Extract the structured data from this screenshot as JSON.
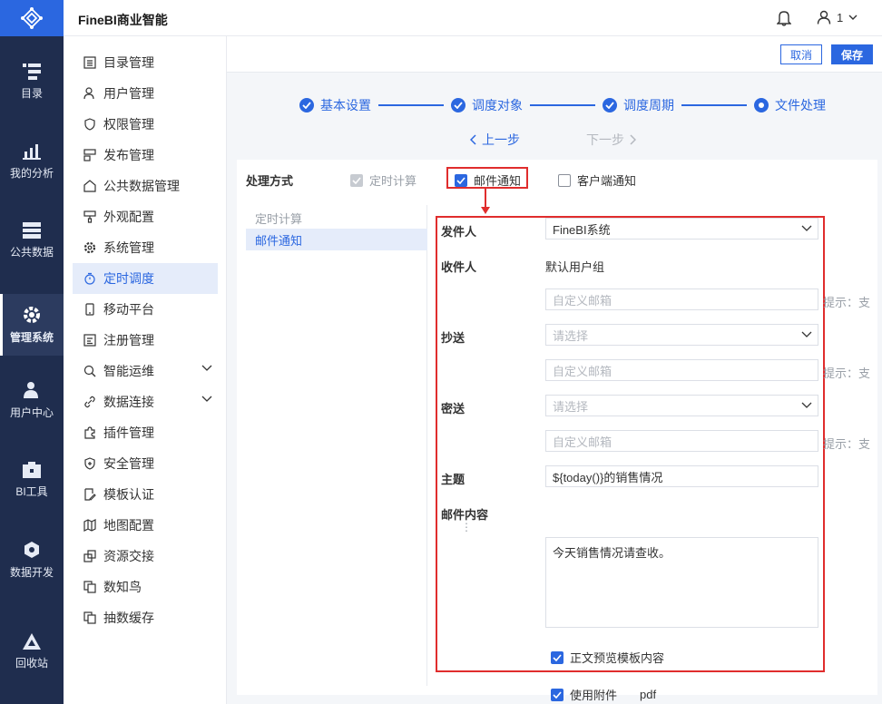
{
  "app": {
    "title": "FineBI商业智能",
    "user": "1"
  },
  "rail": [
    {
      "label": "目录",
      "icon": "catalog-icon"
    },
    {
      "label": "我的分析",
      "icon": "analysis-icon"
    },
    {
      "label": "公共数据",
      "icon": "data-icon"
    },
    {
      "label": "管理系统",
      "icon": "gear-icon"
    },
    {
      "label": "用户中心",
      "icon": "user-center-icon"
    },
    {
      "label": "BI工具",
      "icon": "toolbox-icon"
    },
    {
      "label": "数据开发",
      "icon": "dev-icon"
    },
    {
      "label": "回收站",
      "icon": "recycle-icon"
    }
  ],
  "menu": [
    "目录管理",
    "用户管理",
    "权限管理",
    "发布管理",
    "公共数据管理",
    "外观配置",
    "系统管理",
    "定时调度",
    "移动平台",
    "注册管理",
    "智能运维",
    "数据连接",
    "插件管理",
    "安全管理",
    "模板认证",
    "地图配置",
    "资源交接",
    "数知鸟",
    "抽数缓存"
  ],
  "actions": {
    "cancel": "取消",
    "save": "保存"
  },
  "steps": [
    "基本设置",
    "调度对象",
    "调度周期",
    "文件处理"
  ],
  "nav": {
    "prev": "上一步",
    "next": "下一步"
  },
  "process": {
    "label": "处理方式",
    "options": {
      "timer": "定时计算",
      "email": "邮件通知",
      "client": "客户端通知"
    }
  },
  "subnav": {
    "timer": "定时计算",
    "email": "邮件通知"
  },
  "form": {
    "sender_label": "发件人",
    "sender_value": "FineBI系统",
    "recipient_label": "收件人",
    "recipient_value": "默认用户组",
    "custom_email_placeholder": "自定义邮箱",
    "hint": "提示：支",
    "cc_label": "抄送",
    "select_placeholder": "请选择",
    "bcc_label": "密送",
    "subject_label": "主题",
    "subject_value": "${today()}的销售情况",
    "content_label": "邮件内容",
    "content_value": "今天销售情况请查收。",
    "preview_label": "正文预览模板内容",
    "attach_label": "使用附件",
    "attach_type": "pdf"
  }
}
